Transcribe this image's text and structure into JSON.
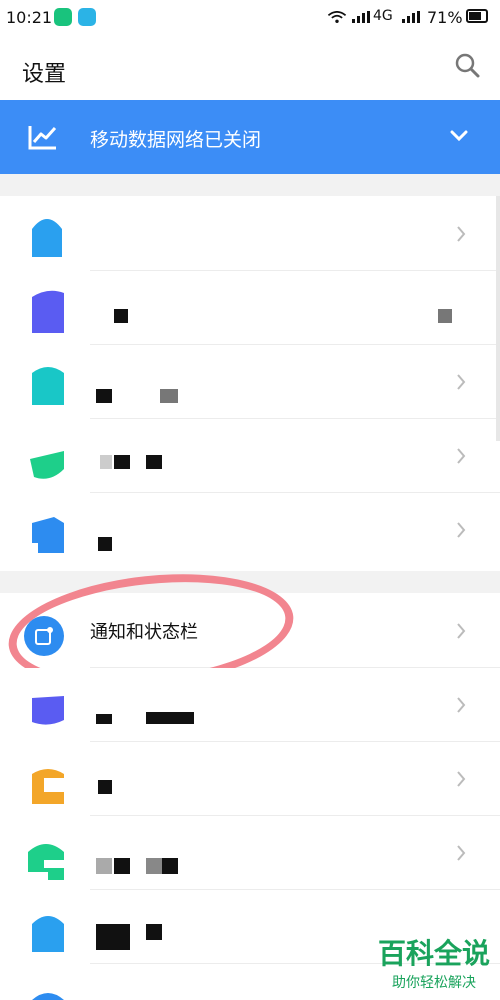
{
  "status_bar": {
    "time": "10:21",
    "network_type": "4G",
    "battery": "71%"
  },
  "header": {
    "title": "设置",
    "search_icon": "search-icon"
  },
  "banner": {
    "text": "移动数据网络已关闭",
    "icon": "trend-icon",
    "chevron": "chevron-down-icon",
    "color": "#3c8df6"
  },
  "rows": [
    {
      "icon_color": "#2aa0ef",
      "label": ""
    },
    {
      "icon_color": "#5a5cf2",
      "label": ""
    },
    {
      "icon_color": "#19c7c7",
      "label": ""
    },
    {
      "icon_color": "#1ecf8a",
      "label": ""
    },
    {
      "icon_color": "#2d8cf0",
      "label": ""
    },
    {
      "icon_color": "#2d8cf0",
      "label": "通知和状态栏"
    },
    {
      "icon_color": "#5a5cf2",
      "label": ""
    },
    {
      "icon_color": "#f3a629",
      "label": ""
    },
    {
      "icon_color": "#1ecf8a",
      "label": ""
    },
    {
      "icon_color": "#2aa0ef",
      "label": ""
    }
  ],
  "watermark": {
    "big": "百科全说",
    "small": "助你轻松解决",
    "color": "#1aa35c"
  }
}
